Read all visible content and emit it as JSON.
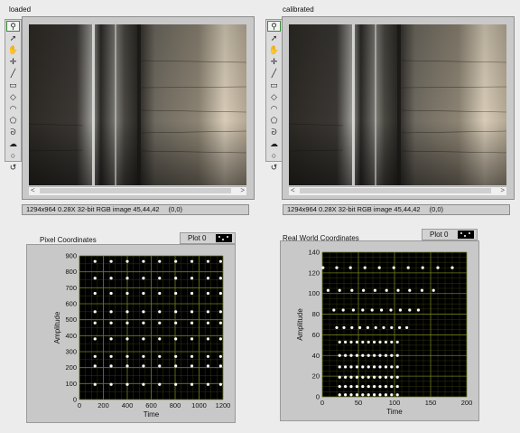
{
  "left_display": {
    "label": "loaded",
    "status": {
      "info": "1294x964 0.28X 32-bit RGB image 45,44,42",
      "coords": "(0,0)"
    }
  },
  "right_display": {
    "label": "calibrated",
    "status": {
      "info": "1294x964 0.28X 32-bit RGB image 45,44,42",
      "coords": "(0,0)"
    }
  },
  "tools": [
    {
      "name": "zoom-tool-icon",
      "glyph": "⚲"
    },
    {
      "name": "pointer-tool-icon",
      "glyph": "➚"
    },
    {
      "name": "pan-tool-icon",
      "glyph": "✋"
    },
    {
      "name": "point-tool-icon",
      "glyph": "✛"
    },
    {
      "name": "line-tool-icon",
      "glyph": "╱"
    },
    {
      "name": "rectangle-tool-icon",
      "glyph": "▭"
    },
    {
      "name": "rotated-rectangle-tool-icon",
      "glyph": "◇"
    },
    {
      "name": "annulus-tool-icon",
      "glyph": "◠"
    },
    {
      "name": "polygon-tool-icon",
      "glyph": "⬠"
    },
    {
      "name": "freehand-tool-icon",
      "glyph": "ᘐ"
    },
    {
      "name": "freehand-region-tool-icon",
      "glyph": "☁"
    },
    {
      "name": "oval-tool-icon",
      "glyph": "○"
    },
    {
      "name": "broken-line-tool-icon",
      "glyph": "↺"
    }
  ],
  "pixel_graph": {
    "title": "Pixel Coordinates",
    "legend_label": "Plot 0"
  },
  "world_graph": {
    "title": "Real World Coordinates",
    "legend_label": "Plot 0"
  },
  "colors": {
    "plot_bg": "#000000",
    "grid": "#6f7a1e",
    "points": "#ffffff",
    "frame": "#c8c8c8"
  },
  "chart_data": [
    {
      "type": "scatter",
      "title": "Pixel Coordinates",
      "xlabel": "Time",
      "ylabel": "Amplitude",
      "xlim": [
        0,
        1200
      ],
      "ylim": [
        0,
        900
      ],
      "xticks": [
        "0",
        "200",
        "400",
        "600",
        "800",
        "1000",
        "1200"
      ],
      "yticks": [
        "0",
        "100",
        "200",
        "300",
        "400",
        "500",
        "600",
        "700",
        "800",
        "900"
      ],
      "grid": true,
      "legend": "top-right",
      "series": [
        {
          "name": "Plot 0",
          "x_values": [
            130,
            265,
            400,
            535,
            670,
            805,
            940,
            1075,
            1180
          ],
          "y_values": [
            95,
            210,
            270,
            380,
            480,
            550,
            665,
            760,
            865
          ]
        }
      ]
    },
    {
      "type": "scatter",
      "title": "Real World Coordinates",
      "xlabel": "Time",
      "ylabel": "Amplitude",
      "xlim": [
        0,
        200
      ],
      "ylim": [
        0,
        140
      ],
      "xticks": [
        "0",
        "50",
        "100",
        "150",
        "200"
      ],
      "yticks": [
        "0",
        "20",
        "40",
        "60",
        "80",
        "100",
        "120",
        "140"
      ],
      "grid": true,
      "legend": "top-right",
      "series": [
        {
          "name": "Plot 0",
          "rows": [
            {
              "y": 2,
              "x": [
                24,
                32,
                40,
                48,
                56,
                64,
                72,
                80,
                88,
                96,
                104
              ]
            },
            {
              "y": 10,
              "x": [
                24,
                32,
                40,
                48,
                56,
                64,
                72,
                80,
                88,
                96,
                104
              ]
            },
            {
              "y": 19,
              "x": [
                24,
                32,
                40,
                48,
                56,
                64,
                72,
                80,
                88,
                96,
                104
              ]
            },
            {
              "y": 29,
              "x": [
                24,
                32,
                40,
                48,
                56,
                64,
                72,
                80,
                88,
                96,
                104
              ]
            },
            {
              "y": 40,
              "x": [
                24,
                32,
                40,
                48,
                56,
                64,
                72,
                80,
                88,
                96,
                104
              ]
            },
            {
              "y": 53,
              "x": [
                24,
                32,
                40,
                48,
                56,
                64,
                72,
                80,
                88,
                96,
                104
              ]
            },
            {
              "y": 67,
              "x": [
                20,
                30,
                41,
                52,
                63,
                74,
                85,
                96,
                107,
                117
              ]
            },
            {
              "y": 84,
              "x": [
                16,
                29,
                43,
                56,
                69,
                82,
                95,
                108,
                121,
                133
              ]
            },
            {
              "y": 103,
              "x": [
                8,
                24,
                41,
                57,
                73,
                89,
                105,
                121,
                138,
                154
              ]
            },
            {
              "y": 125,
              "x": [
                1,
                20,
                39,
                59,
                79,
                99,
                119,
                139,
                160,
                180
              ]
            }
          ]
        }
      ]
    }
  ]
}
